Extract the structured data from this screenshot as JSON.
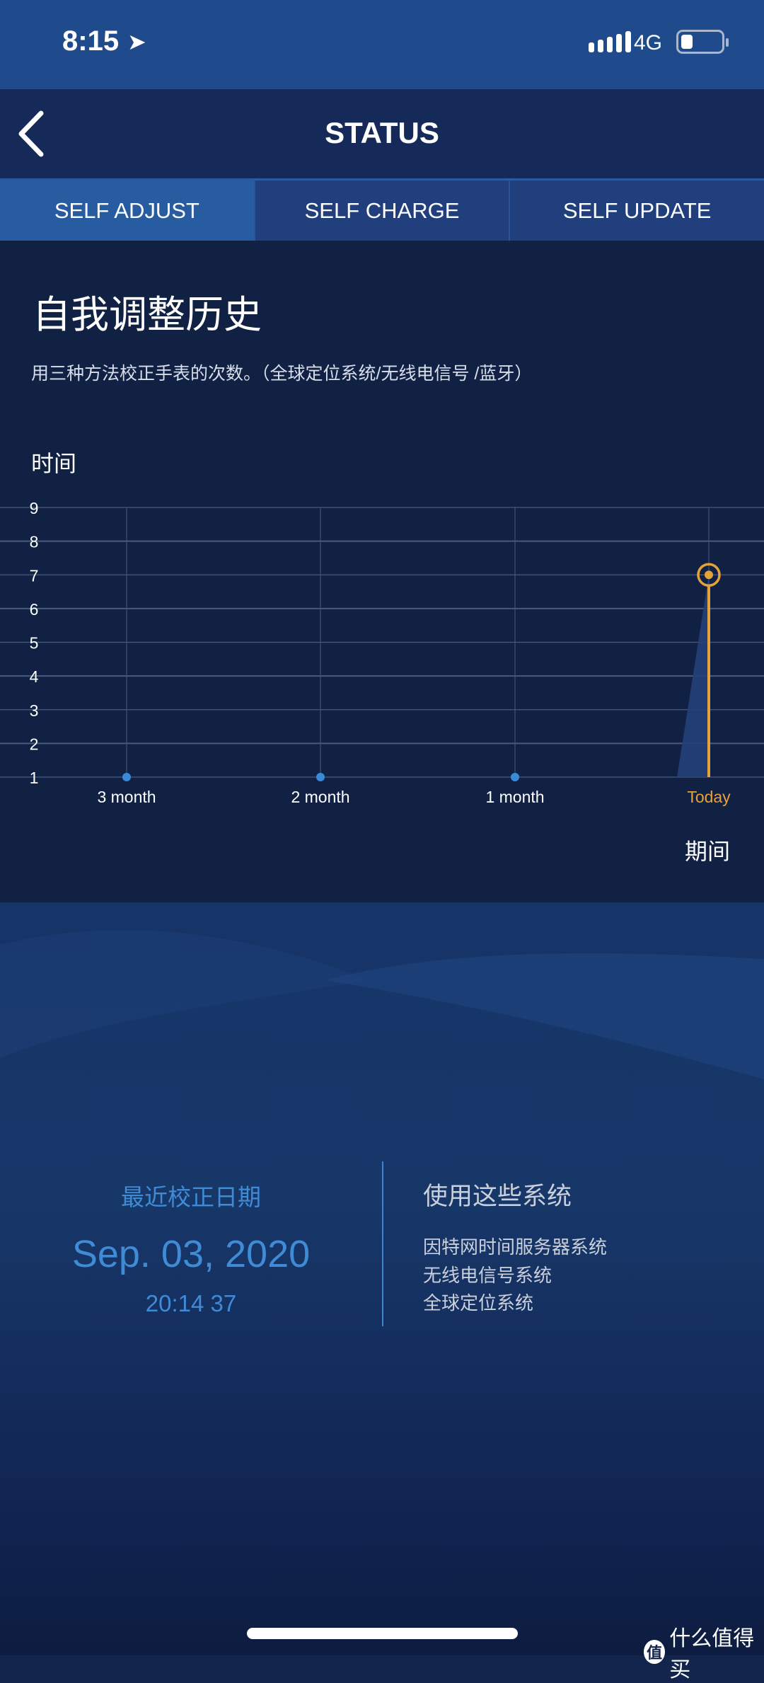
{
  "status_bar": {
    "time": "8:15",
    "network": "4G",
    "battery_level": 0.25,
    "icons": [
      "location-arrow-icon",
      "signal-icon",
      "battery-icon"
    ]
  },
  "nav": {
    "title": "STATUS",
    "back_icon": "chevron-left-icon"
  },
  "tabs": [
    {
      "label": "SELF ADJUST",
      "active": true
    },
    {
      "label": "SELF CHARGE",
      "active": false
    },
    {
      "label": "SELF UPDATE",
      "active": false
    }
  ],
  "section": {
    "title": "自我调整历史",
    "subtitle": "用三种方法校正手表的次数。（全球定位系统/无线电信号 /蓝牙）"
  },
  "chart_data": {
    "type": "line",
    "ylabel": "时间",
    "xlabel": "期间",
    "categories": [
      "3 month",
      "2 month",
      "1 month",
      "Today"
    ],
    "values": [
      1,
      1,
      1,
      7
    ],
    "ylim": [
      1,
      9
    ],
    "yticks": [
      1,
      2,
      3,
      4,
      5,
      6,
      7,
      8,
      9
    ],
    "grid": true,
    "highlight": "Today",
    "colors": {
      "point": "#3a8ad8",
      "highlight": "#e3a23a",
      "grid": "#4a5a7c",
      "area": "#25407a"
    }
  },
  "last_adjust": {
    "label": "最近校正日期",
    "date": "Sep. 03, 2020",
    "time": "20:14 37"
  },
  "systems": {
    "title": "使用这些系统",
    "items": [
      "因特网时间服务器系统",
      "无线电信号系统",
      "全球定位系统"
    ]
  },
  "watermark": {
    "text": "什么值得买",
    "logo_char": "值"
  }
}
